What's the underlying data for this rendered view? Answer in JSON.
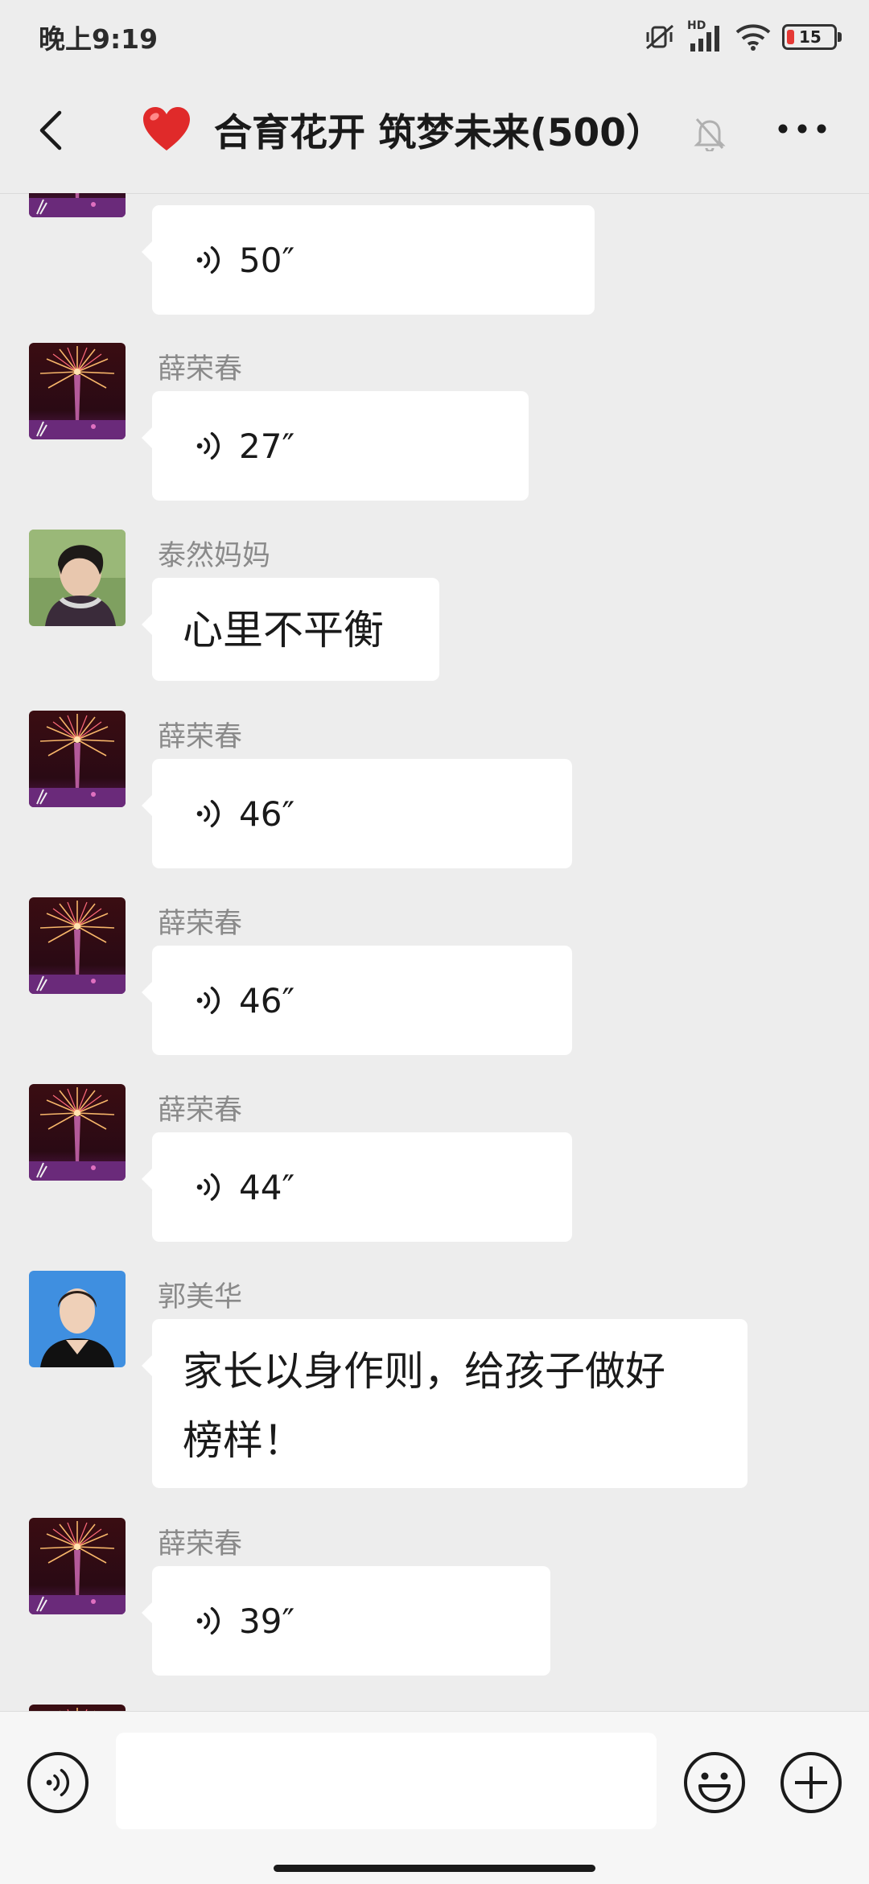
{
  "status_bar": {
    "time": "晚上9:19",
    "network": "HD",
    "battery": "15"
  },
  "header": {
    "title": "合育花开 筑梦未来(500）"
  },
  "messages": [
    {
      "sender": "",
      "type": "voice",
      "duration": "50″"
    },
    {
      "sender": "薛荣春",
      "type": "voice",
      "duration": "27″"
    },
    {
      "sender": "泰然妈妈",
      "type": "text",
      "text": "心里不平衡"
    },
    {
      "sender": "薛荣春",
      "type": "voice",
      "duration": "46″"
    },
    {
      "sender": "薛荣春",
      "type": "voice",
      "duration": "46″"
    },
    {
      "sender": "薛荣春",
      "type": "voice",
      "duration": "44″"
    },
    {
      "sender": "郭美华",
      "type": "text",
      "text_line1": "家长以身作则，给孩子做好",
      "text_line2": "榜样！"
    },
    {
      "sender": "薛荣春",
      "type": "voice",
      "duration": "39″"
    }
  ],
  "input": {
    "value": "",
    "placeholder": ""
  },
  "colors": {
    "background": "#ededed",
    "bubble": "#ffffff",
    "heart": "#e02a2a",
    "battery_low": "#e53935"
  },
  "icons": [
    "back-icon",
    "heart-icon",
    "mute-bell-icon",
    "more-icon",
    "voice-icon",
    "emoji-icon",
    "plus-icon"
  ]
}
